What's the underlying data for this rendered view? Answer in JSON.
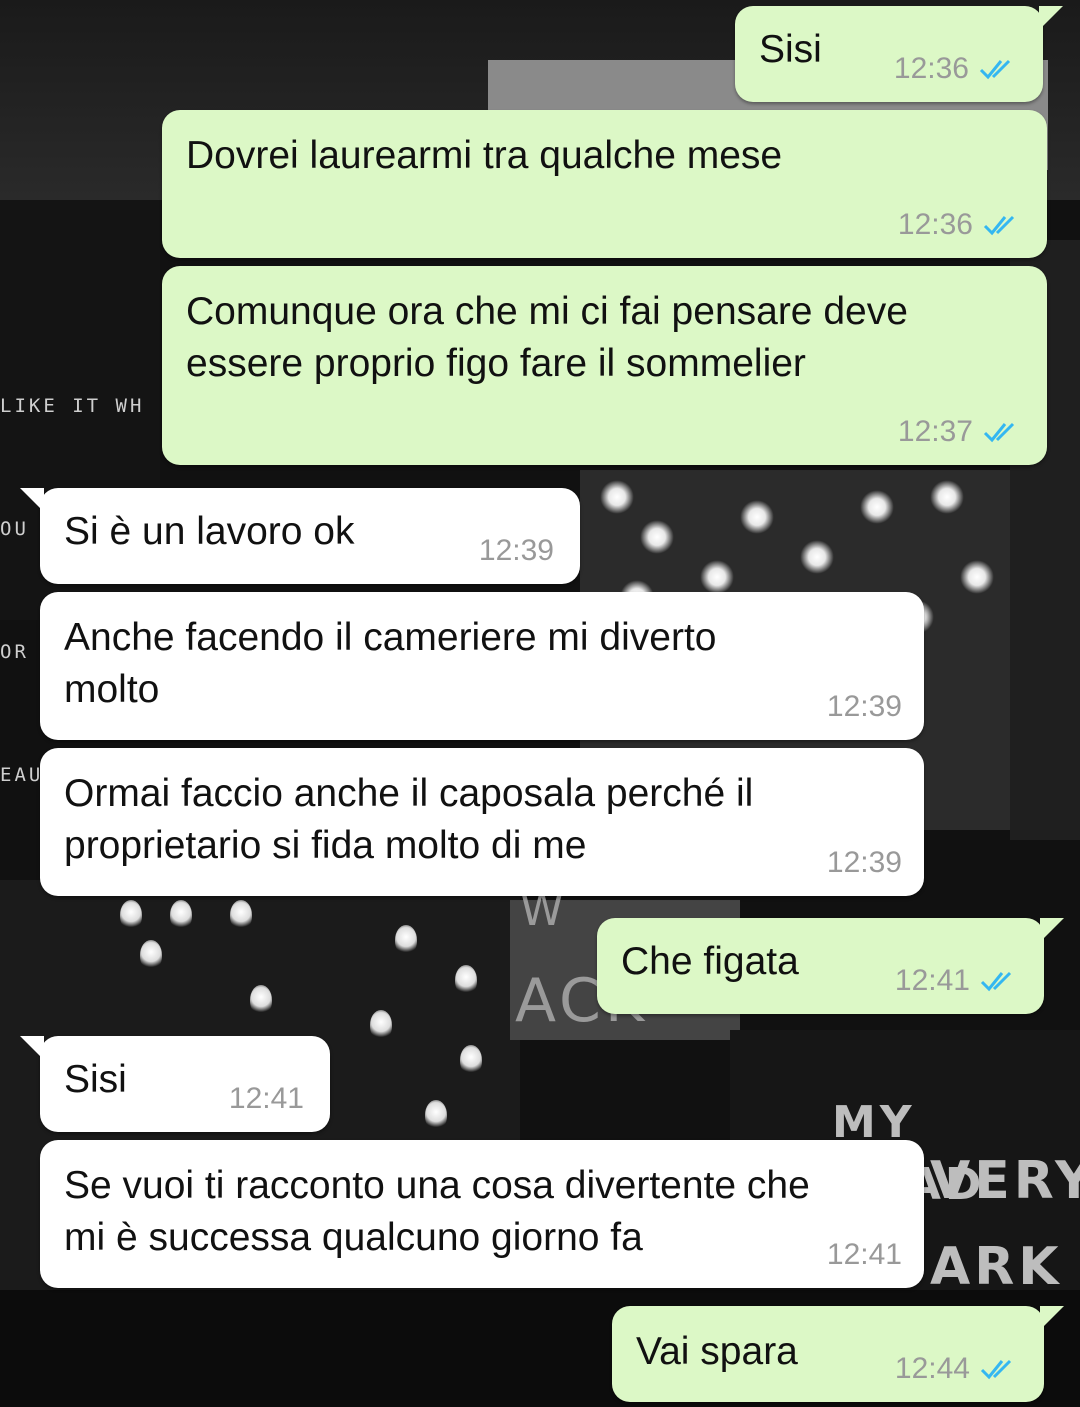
{
  "wallpaper": {
    "neon_lines": [
      "LIKE IT WH",
      "OU SLEEP.",
      "OR YOU ARE",
      "EAUTIFUL Y"
    ],
    "head_lines": [
      "MY HEAD",
      "VERY",
      "ARK"
    ],
    "ack_text": "ACK",
    "w_text": "W"
  },
  "messages": [
    {
      "dir": "out",
      "lines": "Sisi",
      "time": "12:36",
      "status": "read",
      "tick_icon": "double-check-icon",
      "tick_color": "#34b7f1"
    },
    {
      "dir": "out",
      "lines": "Dovrei laurearmi tra qualche mese",
      "time": "12:36",
      "status": "read",
      "tick_icon": "double-check-icon",
      "tick_color": "#34b7f1"
    },
    {
      "dir": "out",
      "lines": "Comunque ora che mi ci fai pensare deve\nessere proprio figo fare il sommelier",
      "time": "12:37",
      "status": "read",
      "tick_icon": "double-check-icon",
      "tick_color": "#34b7f1"
    },
    {
      "dir": "in",
      "lines": "Si è un lavoro ok",
      "time": "12:39"
    },
    {
      "dir": "in",
      "lines": "Anche facendo il cameriere mi diverto\nmolto",
      "time": "12:39"
    },
    {
      "dir": "in",
      "lines": "Ormai faccio anche il caposala perché il\nproprietario si fida molto di me",
      "time": "12:39"
    },
    {
      "dir": "out",
      "lines": "Che figata",
      "time": "12:41",
      "status": "read",
      "tick_icon": "double-check-icon",
      "tick_color": "#34b7f1"
    },
    {
      "dir": "in",
      "lines": "Sisi",
      "time": "12:41"
    },
    {
      "dir": "in",
      "lines": "Se vuoi ti racconto una cosa divertente che\nmi è successa qualcuno giorno fa",
      "time": "12:41"
    },
    {
      "dir": "out",
      "lines": "Vai spara",
      "time": "12:44",
      "status": "read",
      "tick_icon": "double-check-icon",
      "tick_color": "#34b7f1"
    }
  ],
  "colors": {
    "outgoing": "#dcf8c6",
    "incoming": "#ffffff",
    "timestamp": "#999999"
  }
}
